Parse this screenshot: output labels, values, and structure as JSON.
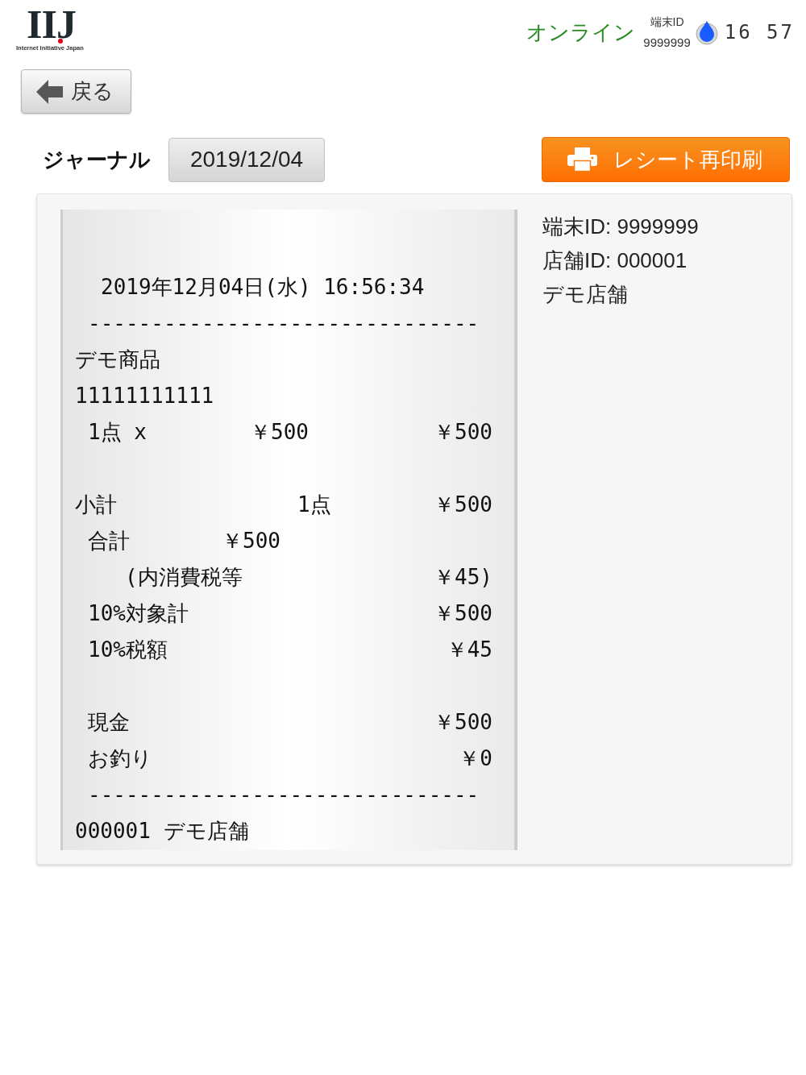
{
  "header": {
    "logo": {
      "mark": "IIJ",
      "tagline": "Internet Initiative Japan"
    },
    "connection": "オンライン",
    "terminal": {
      "label": "端末ID",
      "id": "9999999"
    },
    "clock": "16 57"
  },
  "back_button": {
    "label": "戻る"
  },
  "journal": {
    "title": "ジャーナル",
    "date": "2019/12/04",
    "reprint_button": {
      "label": "レシート再印刷"
    }
  },
  "receipt": {
    "blocks": [
      {
        "lines": [
          {
            "kind": "datetime",
            "cells": [
              "2019年12月04日(水) 16:56:34"
            ]
          },
          {
            "kind": "rule",
            "cells": [
              "-------------------------------"
            ]
          },
          {
            "kind": "text",
            "cells": [
              "デモ商品"
            ]
          },
          {
            "kind": "text",
            "cells": [
              "11111111111"
            ]
          },
          {
            "kind": "item",
            "cells": [
              "1点 x",
              "￥500",
              "￥500"
            ]
          }
        ]
      },
      {
        "lines": [
          {
            "kind": "subtotal",
            "cells": [
              "小計",
              "1点",
              "￥500"
            ]
          },
          {
            "kind": "total",
            "cells": [
              "合計",
              "￥500"
            ]
          },
          {
            "kind": "note",
            "cells": [
              "(内消費税等",
              "￥45)"
            ]
          },
          {
            "kind": "amount",
            "cells": [
              "10%対象計",
              "￥500"
            ]
          },
          {
            "kind": "amount",
            "cells": [
              "10%税額",
              "￥45"
            ]
          }
        ]
      },
      {
        "lines": [
          {
            "kind": "amount",
            "cells": [
              "現金",
              "￥500"
            ]
          },
          {
            "kind": "amount",
            "cells": [
              "お釣り",
              "￥0"
            ]
          },
          {
            "kind": "rule",
            "cells": [
              "-------------------------------"
            ]
          },
          {
            "kind": "text",
            "cells": [
              "000001 デモ店舗"
            ]
          }
        ]
      }
    ]
  },
  "details": [
    "端末ID: 9999999",
    "店舗ID: 000001",
    "デモ店舗"
  ]
}
